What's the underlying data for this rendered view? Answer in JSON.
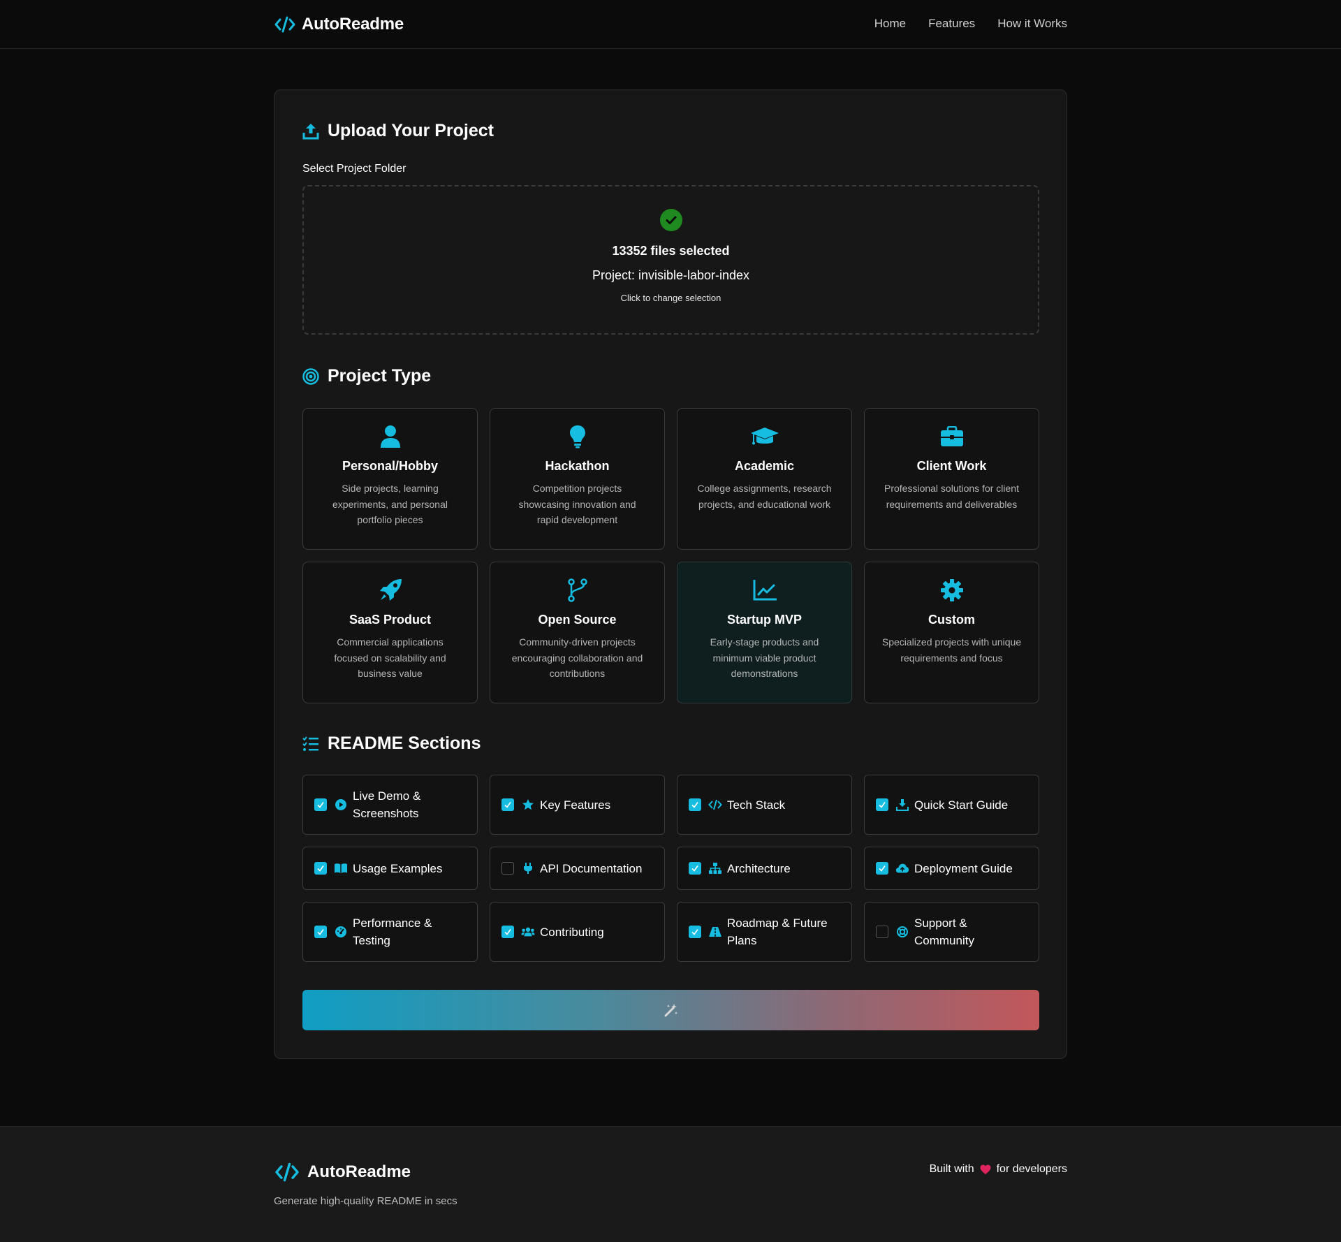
{
  "header": {
    "brand": "AutoReadme",
    "nav": [
      "Home",
      "Features",
      "How it Works"
    ]
  },
  "upload": {
    "title": "Upload Your Project",
    "field_label": "Select Project Folder",
    "files_selected": "13352 files selected",
    "project": "Project: invisible-labor-index",
    "hint": "Click to change selection"
  },
  "project_type": {
    "title": "Project Type",
    "selected": "Startup MVP",
    "items": [
      {
        "title": "Personal/Hobby",
        "desc": "Side projects, learning experiments, and personal portfolio pieces",
        "icon": "user-icon"
      },
      {
        "title": "Hackathon",
        "desc": "Competition projects showcasing innovation and rapid development",
        "icon": "lightbulb-icon"
      },
      {
        "title": "Academic",
        "desc": "College assignments, research projects, and educational work",
        "icon": "graduation-cap-icon"
      },
      {
        "title": "Client Work",
        "desc": "Professional solutions for client requirements and deliverables",
        "icon": "briefcase-icon"
      },
      {
        "title": "SaaS Product",
        "desc": "Commercial applications focused on scalability and business value",
        "icon": "rocket-icon"
      },
      {
        "title": "Open Source",
        "desc": "Community-driven projects encouraging collaboration and contributions",
        "icon": "git-branch-icon"
      },
      {
        "title": "Startup MVP",
        "desc": "Early-stage products and minimum viable product demonstrations",
        "icon": "chart-line-icon"
      },
      {
        "title": "Custom",
        "desc": "Specialized projects with unique requirements and focus",
        "icon": "gear-icon"
      }
    ]
  },
  "readme_sections": {
    "title": "README Sections",
    "items": [
      {
        "label": "Live Demo & Screenshots",
        "checked": true,
        "icon": "play-circle-icon"
      },
      {
        "label": "Key Features",
        "checked": true,
        "icon": "star-icon"
      },
      {
        "label": "Tech Stack",
        "checked": true,
        "icon": "code-icon"
      },
      {
        "label": "Quick Start Guide",
        "checked": true,
        "icon": "download-icon"
      },
      {
        "label": "Usage Examples",
        "checked": true,
        "icon": "book-open-icon"
      },
      {
        "label": "API Documentation",
        "checked": false,
        "icon": "plug-icon"
      },
      {
        "label": "Architecture",
        "checked": true,
        "icon": "sitemap-icon"
      },
      {
        "label": "Deployment Guide",
        "checked": true,
        "icon": "cloud-upload-icon"
      },
      {
        "label": "Performance & Testing",
        "checked": true,
        "icon": "gauge-icon"
      },
      {
        "label": "Contributing",
        "checked": true,
        "icon": "users-icon"
      },
      {
        "label": "Roadmap & Future Plans",
        "checked": true,
        "icon": "road-icon"
      },
      {
        "label": "Support & Community",
        "checked": false,
        "icon": "life-ring-icon"
      }
    ]
  },
  "generate_button": {
    "icon": "magic-wand-icon"
  },
  "footer": {
    "brand": "AutoReadme",
    "tagline": "Generate high-quality README in secs",
    "built_prefix": "Built with",
    "built_suffix": "for developers"
  },
  "colors": {
    "accent": "#16bde0",
    "background": "#0b0b0b",
    "card": "#171717",
    "success": "#2e8b2e",
    "heart": "#e0245e"
  }
}
